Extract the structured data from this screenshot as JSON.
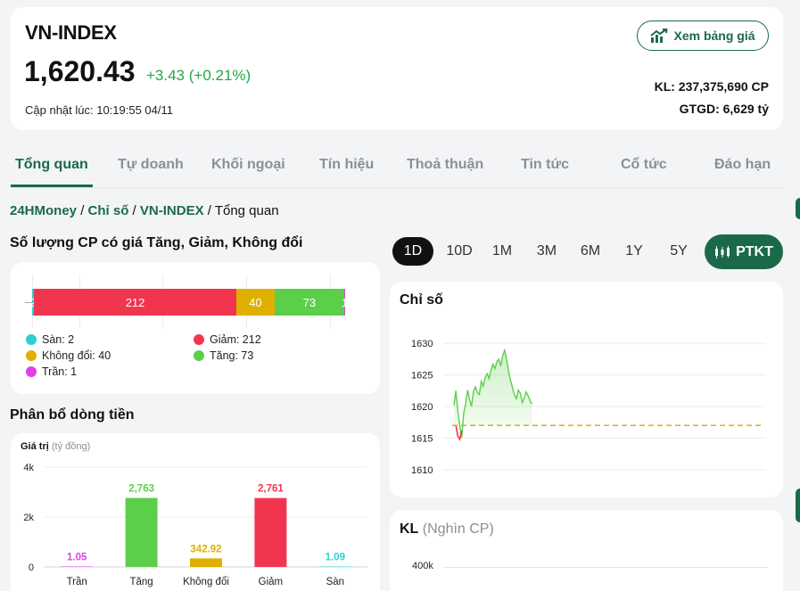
{
  "header": {
    "name": "VN-INDEX",
    "value": "1,620.43",
    "change": "+3.43 (+0.21%)",
    "updated": "Cập nhật lúc: 10:19:55 04/11",
    "board_button": "Xem bảng giá",
    "volume": "KL: 237,375,690 CP",
    "turnover": "GTGD: 6,629 tỷ"
  },
  "tabs": [
    "Tổng quan",
    "Tự doanh",
    "Khối ngoại",
    "Tín hiệu",
    "Thoả thuận",
    "Tin tức",
    "Cổ tức",
    "Đáo hạn"
  ],
  "breadcrumb": {
    "items": [
      "24HMoney",
      "Chỉ số",
      "VN-INDEX"
    ],
    "sep": " / ",
    "current": "Tổng quan"
  },
  "stock_count": {
    "title": "Số lượng CP có giá Tăng, Giảm, Không đổi",
    "segments": [
      {
        "label": "Sàn",
        "value": 2,
        "color": "#2ecfcf"
      },
      {
        "label": "Giảm",
        "value": 212,
        "color": "#f2354f"
      },
      {
        "label": "Không đổi",
        "value": 40,
        "color": "#e0b000"
      },
      {
        "label": "Tăng",
        "value": 73,
        "color": "#5ccf4a"
      },
      {
        "label": "Trần",
        "value": 1,
        "color": "#e03ee8"
      }
    ],
    "legend": [
      {
        "text": "Sàn: 2",
        "color": "#2ecfcf"
      },
      {
        "text": "Giảm: 212",
        "color": "#f2354f"
      },
      {
        "text": "Không đổi: 40",
        "color": "#e0b000"
      },
      {
        "text": "Tăng: 73",
        "color": "#5ccf4a"
      },
      {
        "text": "Trần: 1",
        "color": "#e03ee8"
      }
    ]
  },
  "money_flow": {
    "title": "Phân bổ dòng tiền",
    "axis_title": "Giá trị",
    "axis_unit": "(tỷ đồng)",
    "y_ticks": [
      "4k",
      "2k",
      "0"
    ],
    "ymax": 4000
  },
  "chart_data": [
    {
      "type": "bar",
      "title": "Phân bổ dòng tiền",
      "ylabel": "Giá trị (tỷ đồng)",
      "categories": [
        "Trần",
        "Tăng",
        "Không đổi",
        "Giảm",
        "Sàn"
      ],
      "values": [
        1.05,
        2763,
        342.92,
        2761,
        1.09
      ],
      "value_labels": [
        "1.05",
        "2,763",
        "342.92",
        "2,761",
        "1.09"
      ],
      "colors": [
        "#e03ee8",
        "#5ccf4a",
        "#e0b000",
        "#f2354f",
        "#2ecfcf"
      ],
      "ylim": [
        0,
        4000
      ]
    },
    {
      "type": "line",
      "title": "Chỉ số",
      "y_ticks": [
        "1630",
        "1625",
        "1620",
        "1615",
        "1610"
      ],
      "ylim": [
        1608,
        1632
      ],
      "reference": 1617,
      "x": [
        0,
        1,
        2,
        3,
        4,
        5,
        6,
        7,
        8,
        9,
        10,
        11,
        12,
        13,
        14,
        15,
        16,
        17,
        18,
        19,
        20,
        21,
        22,
        23,
        24,
        25,
        26,
        27,
        28,
        29,
        30,
        31,
        32,
        33,
        34,
        35,
        36,
        37,
        38,
        39,
        40
      ],
      "y": [
        1620.2,
        1622.5,
        1619.2,
        1616.8,
        1615.1,
        1619.0,
        1620.4,
        1622.6,
        1621.1,
        1620.0,
        1622.4,
        1623.1,
        1622.2,
        1621.9,
        1624.0,
        1623.2,
        1624.6,
        1625.2,
        1624.4,
        1625.8,
        1626.7,
        1626.0,
        1627.1,
        1627.5,
        1626.4,
        1628.1,
        1628.9,
        1627.4,
        1625.6,
        1624.1,
        1623.0,
        1621.8,
        1621.2,
        1622.6,
        1622.1,
        1620.6,
        1621.3,
        1622.3,
        1621.7,
        1620.9,
        1620.4
      ],
      "x_total": 160,
      "down_segment": [
        [
          1,
          1617.0
        ],
        [
          2,
          1615.3
        ],
        [
          3,
          1614.8
        ],
        [
          4,
          1616.2
        ]
      ]
    }
  ],
  "periods": [
    "1D",
    "10D",
    "1M",
    "3M",
    "6M",
    "1Y",
    "5Y"
  ],
  "active_period": "1D",
  "ptkt_label": "PTKT",
  "index_chart": {
    "title": "Chỉ số"
  },
  "volume_chart": {
    "title": "KL",
    "unit": "(Nghìn CP)",
    "first_tick": "400k"
  },
  "colors": {
    "brand": "#1a6a4a",
    "up": "#22a845",
    "down": "#f2354f",
    "reference": "#e0b000"
  }
}
